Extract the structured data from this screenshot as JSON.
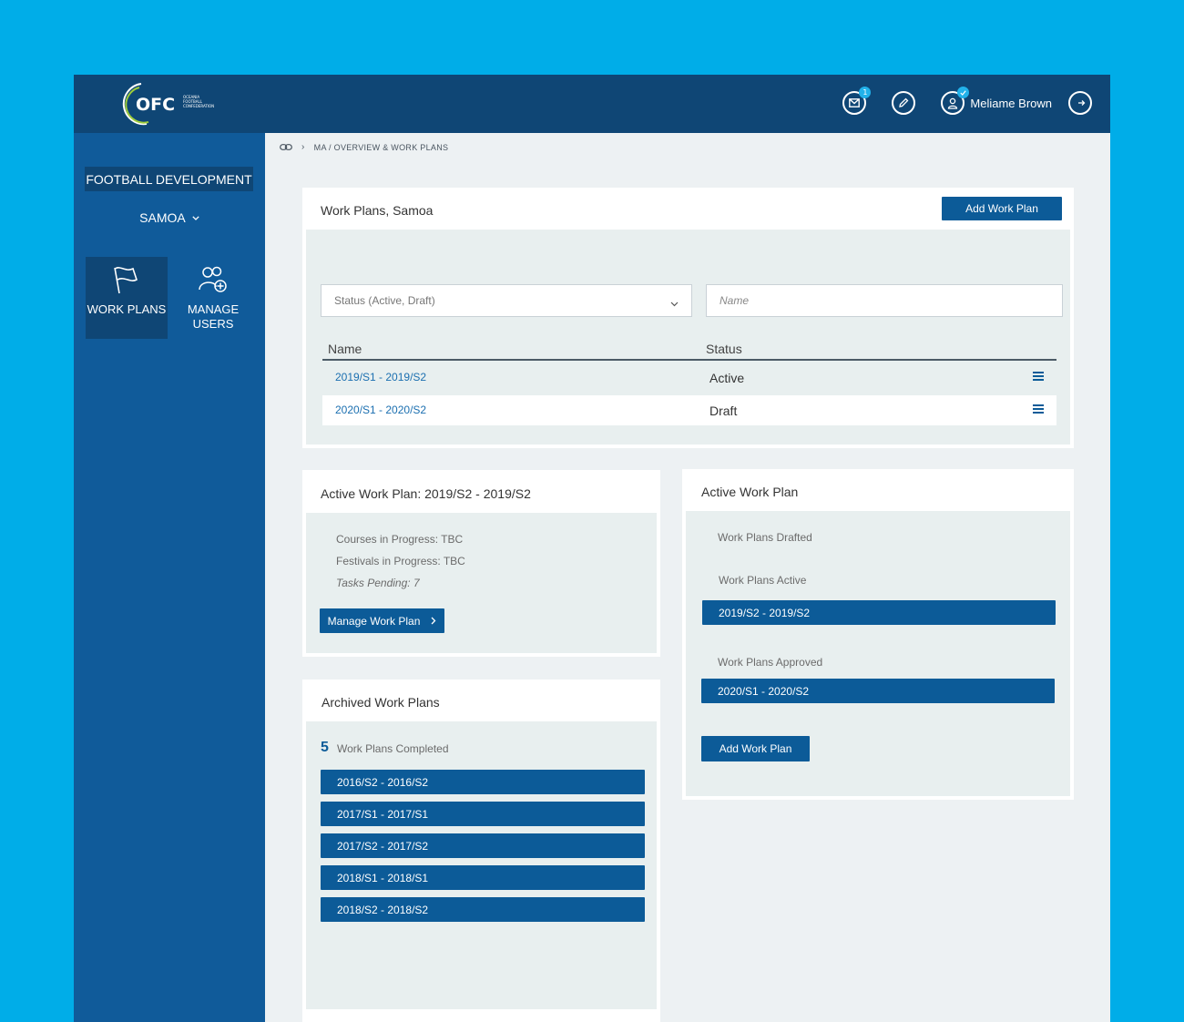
{
  "header": {
    "logo_text": "OFC",
    "logo_subtext": [
      "OCEANIA",
      "FOOTBALL",
      "CONFEDERATION"
    ],
    "messages_badge": "1",
    "user_name": "Meliame Brown"
  },
  "sidebar": {
    "section_label": "FOOTBALL DEVELOPMENT",
    "country": "SAMOA",
    "items": [
      {
        "label": "WORK PLANS",
        "icon": "flag-icon",
        "active": true
      },
      {
        "label_line1": "MANAGE",
        "label_line2": "USERS",
        "icon": "users-add-icon",
        "active": false
      }
    ]
  },
  "breadcrumb": {
    "path": "MA / OVERVIEW & WORK PLANS"
  },
  "work_plans": {
    "title": "Work Plans, Samoa",
    "add_button": "Add Work Plan",
    "status_filter_placeholder": "Status (Active, Draft)",
    "name_filter_placeholder": "Name",
    "columns": [
      "Name",
      "Status"
    ],
    "rows": [
      {
        "name": "2019/S1 - 2019/S2",
        "status": "Active"
      },
      {
        "name": "2020/S1 - 2020/S2",
        "status": "Draft"
      }
    ]
  },
  "active_plan": {
    "title": "Active Work Plan: 2019/S2 - 2019/S2",
    "courses": "Courses in Progress: TBC",
    "festivals": "Festivals in Progress: TBC",
    "tasks": "Tasks Pending: 7",
    "manage_button": "Manage Work Plan"
  },
  "archived": {
    "title": "Archived Work Plans",
    "count": "5",
    "count_label": "Work Plans Completed",
    "plans": [
      "2016/S2 - 2016/S2",
      "2017/S1 - 2017/S1",
      "2017/S2 - 2017/S2",
      "2018/S1 - 2018/S1",
      "2018/S2 - 2018/S2"
    ]
  },
  "active_summary": {
    "title": "Active Work Plan",
    "drafted_label": "Work Plans Drafted",
    "active_label": "Work Plans Active",
    "active_plan": "2019/S2 - 2019/S2",
    "approved_label": "Work Plans Approved",
    "approved_plan": "2020/S1 - 2020/S2",
    "add_button": "Add Work Plan"
  },
  "colors": {
    "background": "#00ade8",
    "topbar": "#0f4675",
    "sidebar": "#105b9a",
    "accent": "#0c5b98",
    "link": "#1b6fb0"
  }
}
